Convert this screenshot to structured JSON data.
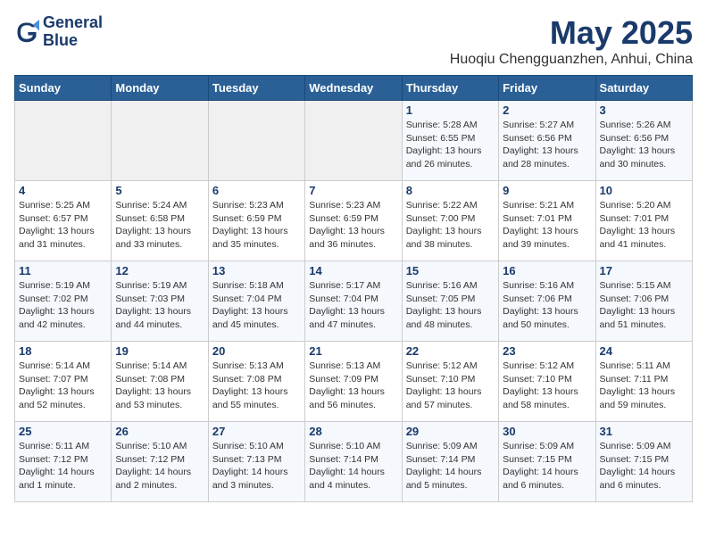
{
  "logo": {
    "line1": "General",
    "line2": "Blue"
  },
  "title": "May 2025",
  "subtitle": "Huoqiu Chengguanzhen, Anhui, China",
  "weekdays": [
    "Sunday",
    "Monday",
    "Tuesday",
    "Wednesday",
    "Thursday",
    "Friday",
    "Saturday"
  ],
  "weeks": [
    [
      {
        "day": null
      },
      {
        "day": null
      },
      {
        "day": null
      },
      {
        "day": null
      },
      {
        "day": 1,
        "sunrise": "5:28 AM",
        "sunset": "6:55 PM",
        "daylight": "13 hours and 26 minutes."
      },
      {
        "day": 2,
        "sunrise": "5:27 AM",
        "sunset": "6:56 PM",
        "daylight": "13 hours and 28 minutes."
      },
      {
        "day": 3,
        "sunrise": "5:26 AM",
        "sunset": "6:56 PM",
        "daylight": "13 hours and 30 minutes."
      }
    ],
    [
      {
        "day": 4,
        "sunrise": "5:25 AM",
        "sunset": "6:57 PM",
        "daylight": "13 hours and 31 minutes."
      },
      {
        "day": 5,
        "sunrise": "5:24 AM",
        "sunset": "6:58 PM",
        "daylight": "13 hours and 33 minutes."
      },
      {
        "day": 6,
        "sunrise": "5:23 AM",
        "sunset": "6:59 PM",
        "daylight": "13 hours and 35 minutes."
      },
      {
        "day": 7,
        "sunrise": "5:23 AM",
        "sunset": "6:59 PM",
        "daylight": "13 hours and 36 minutes."
      },
      {
        "day": 8,
        "sunrise": "5:22 AM",
        "sunset": "7:00 PM",
        "daylight": "13 hours and 38 minutes."
      },
      {
        "day": 9,
        "sunrise": "5:21 AM",
        "sunset": "7:01 PM",
        "daylight": "13 hours and 39 minutes."
      },
      {
        "day": 10,
        "sunrise": "5:20 AM",
        "sunset": "7:01 PM",
        "daylight": "13 hours and 41 minutes."
      }
    ],
    [
      {
        "day": 11,
        "sunrise": "5:19 AM",
        "sunset": "7:02 PM",
        "daylight": "13 hours and 42 minutes."
      },
      {
        "day": 12,
        "sunrise": "5:19 AM",
        "sunset": "7:03 PM",
        "daylight": "13 hours and 44 minutes."
      },
      {
        "day": 13,
        "sunrise": "5:18 AM",
        "sunset": "7:04 PM",
        "daylight": "13 hours and 45 minutes."
      },
      {
        "day": 14,
        "sunrise": "5:17 AM",
        "sunset": "7:04 PM",
        "daylight": "13 hours and 47 minutes."
      },
      {
        "day": 15,
        "sunrise": "5:16 AM",
        "sunset": "7:05 PM",
        "daylight": "13 hours and 48 minutes."
      },
      {
        "day": 16,
        "sunrise": "5:16 AM",
        "sunset": "7:06 PM",
        "daylight": "13 hours and 50 minutes."
      },
      {
        "day": 17,
        "sunrise": "5:15 AM",
        "sunset": "7:06 PM",
        "daylight": "13 hours and 51 minutes."
      }
    ],
    [
      {
        "day": 18,
        "sunrise": "5:14 AM",
        "sunset": "7:07 PM",
        "daylight": "13 hours and 52 minutes."
      },
      {
        "day": 19,
        "sunrise": "5:14 AM",
        "sunset": "7:08 PM",
        "daylight": "13 hours and 53 minutes."
      },
      {
        "day": 20,
        "sunrise": "5:13 AM",
        "sunset": "7:08 PM",
        "daylight": "13 hours and 55 minutes."
      },
      {
        "day": 21,
        "sunrise": "5:13 AM",
        "sunset": "7:09 PM",
        "daylight": "13 hours and 56 minutes."
      },
      {
        "day": 22,
        "sunrise": "5:12 AM",
        "sunset": "7:10 PM",
        "daylight": "13 hours and 57 minutes."
      },
      {
        "day": 23,
        "sunrise": "5:12 AM",
        "sunset": "7:10 PM",
        "daylight": "13 hours and 58 minutes."
      },
      {
        "day": 24,
        "sunrise": "5:11 AM",
        "sunset": "7:11 PM",
        "daylight": "13 hours and 59 minutes."
      }
    ],
    [
      {
        "day": 25,
        "sunrise": "5:11 AM",
        "sunset": "7:12 PM",
        "daylight": "14 hours and 1 minute."
      },
      {
        "day": 26,
        "sunrise": "5:10 AM",
        "sunset": "7:12 PM",
        "daylight": "14 hours and 2 minutes."
      },
      {
        "day": 27,
        "sunrise": "5:10 AM",
        "sunset": "7:13 PM",
        "daylight": "14 hours and 3 minutes."
      },
      {
        "day": 28,
        "sunrise": "5:10 AM",
        "sunset": "7:14 PM",
        "daylight": "14 hours and 4 minutes."
      },
      {
        "day": 29,
        "sunrise": "5:09 AM",
        "sunset": "7:14 PM",
        "daylight": "14 hours and 5 minutes."
      },
      {
        "day": 30,
        "sunrise": "5:09 AM",
        "sunset": "7:15 PM",
        "daylight": "14 hours and 6 minutes."
      },
      {
        "day": 31,
        "sunrise": "5:09 AM",
        "sunset": "7:15 PM",
        "daylight": "14 hours and 6 minutes."
      }
    ]
  ]
}
